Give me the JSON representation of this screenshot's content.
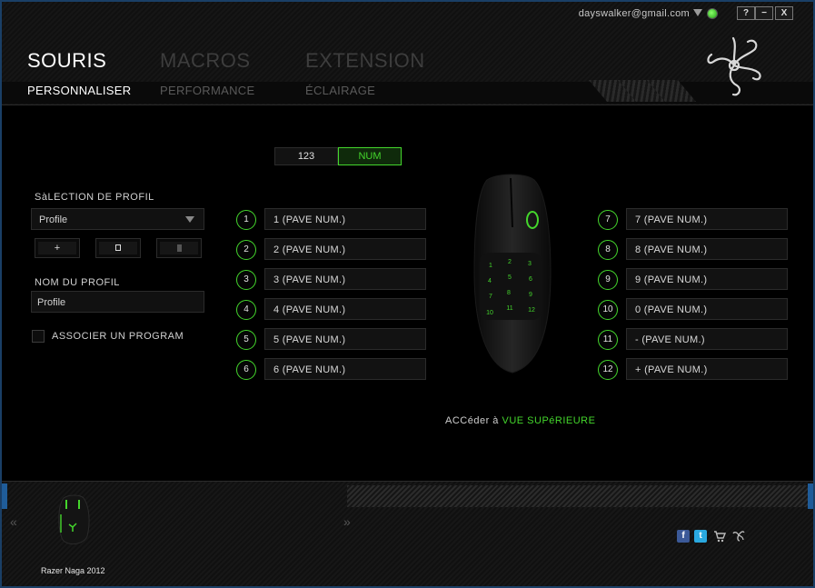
{
  "account": {
    "email": "dayswalker@gmail.com"
  },
  "window_buttons": {
    "help": "?",
    "minimize": "−",
    "close": "X"
  },
  "top_tabs": [
    {
      "label": "SOURIS",
      "active": true
    },
    {
      "label": "MACROS",
      "active": false
    },
    {
      "label": "EXTENSION",
      "active": false
    }
  ],
  "sub_tabs": [
    {
      "label": "PERSONNALISER",
      "active": true
    },
    {
      "label": "PERFORMANCE",
      "active": false
    },
    {
      "label": "ÉCLAIRAGE",
      "active": false
    }
  ],
  "profile": {
    "selection_label": "SàLECTION DE PROFIL",
    "selected": "Profile",
    "add_label": "+",
    "name_label": "NOM DU PROFIL",
    "name_value": "Profile",
    "associate_label": "ASSOCIER UN PROGRAM"
  },
  "keypad_toggle": {
    "left": "123",
    "right": "NUM",
    "active": "right"
  },
  "buttons_left": [
    {
      "num": "1",
      "assign": "1 (PAVE NUM.)"
    },
    {
      "num": "2",
      "assign": "2 (PAVE NUM.)"
    },
    {
      "num": "3",
      "assign": "3 (PAVE NUM.)"
    },
    {
      "num": "4",
      "assign": "4 (PAVE NUM.)"
    },
    {
      "num": "5",
      "assign": "5 (PAVE NUM.)"
    },
    {
      "num": "6",
      "assign": "6 (PAVE NUM.)"
    }
  ],
  "buttons_right": [
    {
      "num": "7",
      "assign": "7 (PAVE NUM.)"
    },
    {
      "num": "8",
      "assign": "8 (PAVE NUM.)"
    },
    {
      "num": "9",
      "assign": "9 (PAVE NUM.)"
    },
    {
      "num": "10",
      "assign": "0 (PAVE NUM.)"
    },
    {
      "num": "11",
      "assign": "- (PAVE NUM.)"
    },
    {
      "num": "12",
      "assign": "+ (PAVE NUM.)"
    }
  ],
  "mouse_keys": [
    "1",
    "2",
    "3",
    "4",
    "5",
    "6",
    "7",
    "8",
    "9",
    "10",
    "11",
    "12"
  ],
  "access": {
    "prefix": "ACCéder à",
    "link": "VUE SUPéRIEURE"
  },
  "footer": {
    "device_name": "Razer Naga 2012",
    "prev": "«",
    "next": "»"
  },
  "colors": {
    "accent": "#44d62c",
    "frame": "#1f5c99"
  }
}
